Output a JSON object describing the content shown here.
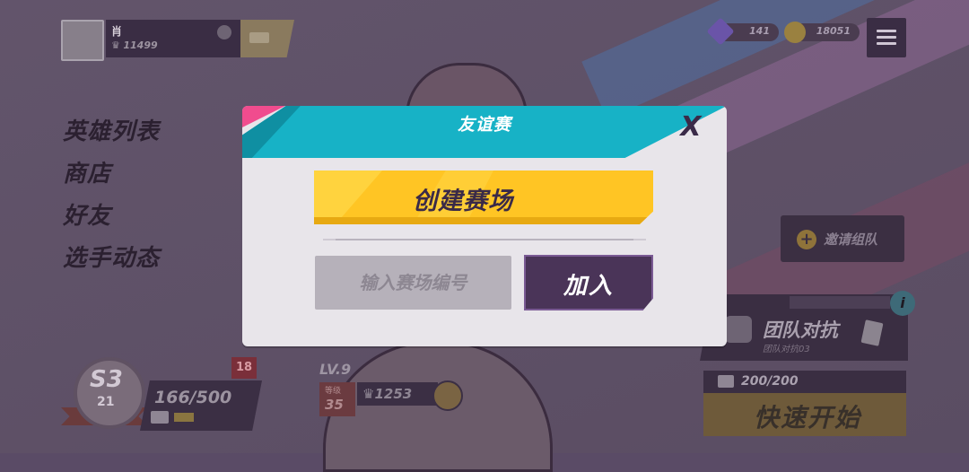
{
  "topbar": {
    "player_name": "肖",
    "trophies": "11499",
    "gems": "141",
    "coins": "18051"
  },
  "left_nav": [
    "英雄列表",
    "商店",
    "好友",
    "选手动态"
  ],
  "invite": {
    "label": "邀请组队"
  },
  "mode": {
    "title": "团队对抗",
    "subtitle": "团队对抗03",
    "info": "i"
  },
  "quick_start": {
    "energy": "200/200",
    "label": "快速开始"
  },
  "season": {
    "badge": "S3",
    "level": "21",
    "progress": "166/500",
    "fill": 0.332,
    "notification": "18"
  },
  "hero": {
    "level": "LV.9",
    "rank_label": "等级",
    "rank": "35",
    "trophies": "1253"
  },
  "dialog": {
    "title": "友谊赛",
    "close": "X",
    "create_label": "创建赛场",
    "room_input_placeholder": "输入赛场编号",
    "join_label": "加入",
    "colors": {
      "header": "#17b2c6",
      "accent": "#f04c8e",
      "create": "#ffc524",
      "join": "#4a3458"
    }
  }
}
